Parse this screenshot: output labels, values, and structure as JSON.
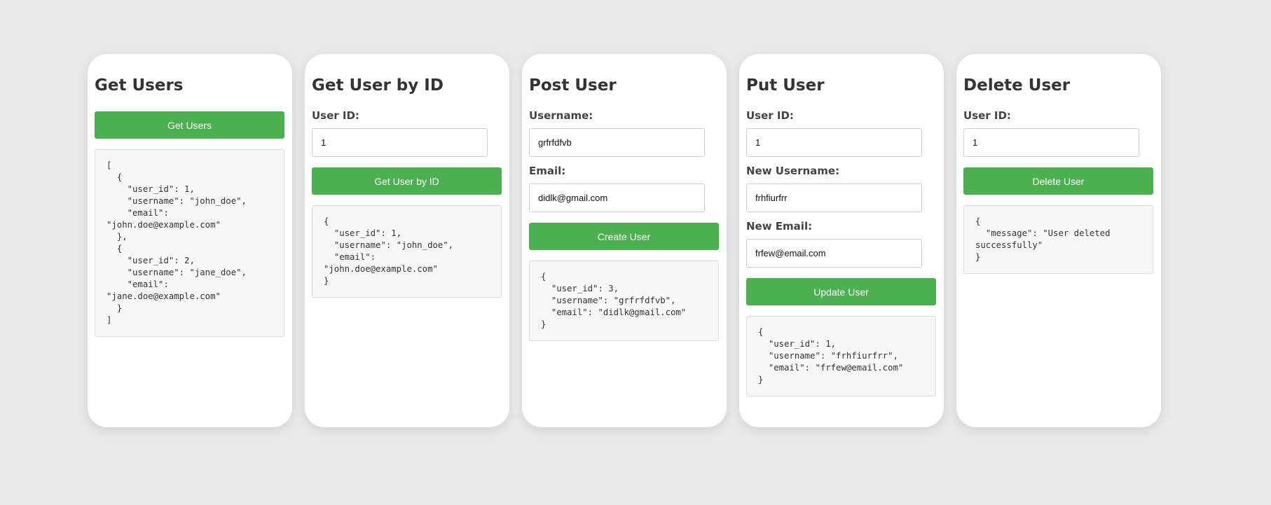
{
  "cards": {
    "get_users": {
      "title": "Get Users",
      "button": "Get Users",
      "result": "[\n  {\n    \"user_id\": 1,\n    \"username\": \"john_doe\",\n    \"email\":\n\"john.doe@example.com\"\n  },\n  {\n    \"user_id\": 2,\n    \"username\": \"jane_doe\",\n    \"email\":\n\"jane.doe@example.com\"\n  }\n]"
    },
    "get_user_by_id": {
      "title": "Get User by ID",
      "user_id_label": "User ID:",
      "user_id_value": "1",
      "button": "Get User by ID",
      "result": "{\n  \"user_id\": 1,\n  \"username\": \"john_doe\",\n  \"email\":\n\"john.doe@example.com\"\n}"
    },
    "post_user": {
      "title": "Post User",
      "username_label": "Username:",
      "username_value": "grfrfdfvb",
      "email_label": "Email:",
      "email_value": "didlk@gmail.com",
      "button": "Create User",
      "result": "{\n  \"user_id\": 3,\n  \"username\": \"grfrfdfvb\",\n  \"email\": \"didlk@gmail.com\"\n}"
    },
    "put_user": {
      "title": "Put User",
      "user_id_label": "User ID:",
      "user_id_value": "1",
      "new_username_label": "New Username:",
      "new_username_value": "frhfiurfrr",
      "new_email_label": "New Email:",
      "new_email_value": "frfew@email.com",
      "button": "Update User",
      "result": "{\n  \"user_id\": 1,\n  \"username\": \"frhfiurfrr\",\n  \"email\": \"frfew@email.com\"\n}"
    },
    "delete_user": {
      "title": "Delete User",
      "user_id_label": "User ID:",
      "user_id_value": "1",
      "button": "Delete User",
      "result": "{\n  \"message\": \"User deleted\nsuccessfully\"\n}"
    }
  },
  "colors": {
    "background": "#e9e9e9",
    "card": "#ffffff",
    "button": "#4caf50",
    "button_text": "#ffffff",
    "result_bg": "#f7f7f7"
  }
}
